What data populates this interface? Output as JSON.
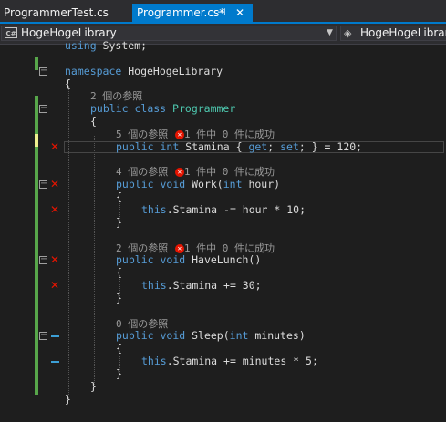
{
  "tabs": [
    {
      "label": "ProgrammerTest.cs",
      "active": false
    },
    {
      "label": "Programmer.cs*",
      "active": true,
      "pin_icon": "pin-icon",
      "close_icon": "close-icon"
    }
  ],
  "navbar": {
    "left_label": "HogeHogeLibrary",
    "left_icon": "csharp-project-icon",
    "right_label": "HogeHogeLibrary",
    "right_icon": "component-icon",
    "dropdown_icon": "chevron-down-icon"
  },
  "colors": {
    "keyword": "#569cd6",
    "type": "#4ec9b0",
    "text": "#dcdcdc",
    "lens": "#999999",
    "error": "#e51400",
    "saved_change": "#57a64a",
    "unsaved_change": "#efef8f",
    "accent": "#007acc"
  },
  "code": {
    "l1_using": "using",
    "l1_rest": " System;",
    "l3_namespace": "namespace",
    "l3_rest": " HogeHogeLibrary",
    "l4": "{",
    "lens_class": "2 個の参照",
    "class_public": "public",
    "class_class": "class",
    "class_name": "Programmer",
    "class_open": "{",
    "lens_prop_refs": "5 個の参照|",
    "lens_prop_tests": "1 件中 0 件に成功",
    "prop_public": "public",
    "prop_int": "int",
    "prop_name": " Stamina { ",
    "prop_get": "get",
    "prop_sep": "; ",
    "prop_set": "set",
    "prop_tail": "; } = 120;",
    "lens_work_refs": "4 個の参照|",
    "lens_work_tests": "1 件中 0 件に成功",
    "work_public": "public",
    "work_void": "void",
    "work_name": " Work(",
    "work_int": "int",
    "work_tail": " hour)",
    "work_open": "{",
    "work_this": "this",
    "work_body": ".Stamina -= hour * 10;",
    "work_close": "}",
    "lens_lunch_refs": "2 個の参照|",
    "lens_lunch_tests": "1 件中 0 件に成功",
    "lunch_public": "public",
    "lunch_void": "void",
    "lunch_name": " HaveLunch()",
    "lunch_open": "{",
    "lunch_this": "this",
    "lunch_body": ".Stamina += 30;",
    "lunch_close": "}",
    "lens_sleep": "0 個の参照",
    "sleep_public": "public",
    "sleep_void": "void",
    "sleep_name": " Sleep(",
    "sleep_int": "int",
    "sleep_tail": " minutes)",
    "sleep_open": "{",
    "sleep_this": "this",
    "sleep_body": ".Stamina += minutes * 5;",
    "sleep_close": "}",
    "class_close": "}",
    "ns_close": "}"
  },
  "glyphs": {
    "pin": "⊣",
    "close": "✕",
    "chevron": "▼",
    "collapse": "−",
    "fail_x": "✕",
    "fail_badge": "✕",
    "csharp": "C#",
    "component": "◈"
  }
}
